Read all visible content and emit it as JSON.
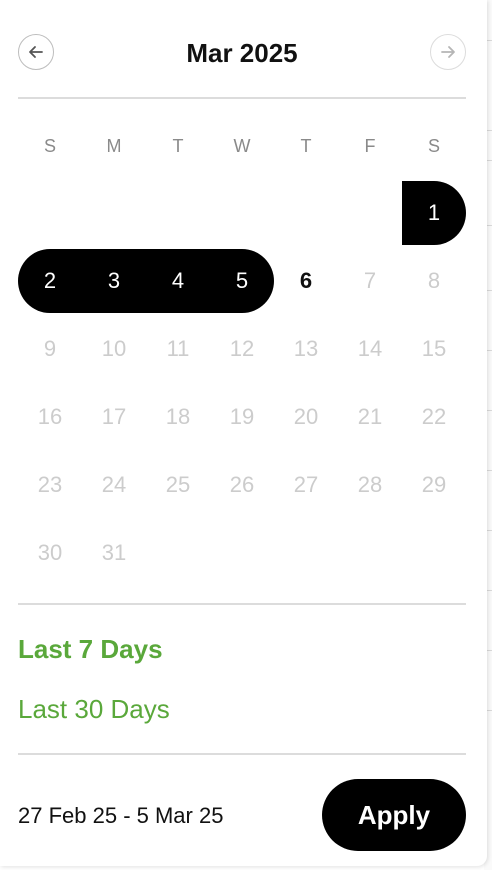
{
  "calendar": {
    "title": "Mar 2025",
    "weekdays": [
      "S",
      "M",
      "T",
      "W",
      "T",
      "F",
      "S"
    ],
    "weeks": [
      [
        null,
        null,
        null,
        null,
        null,
        null,
        {
          "day": "1",
          "state": "selected"
        }
      ],
      [
        {
          "day": "2",
          "state": "selected"
        },
        {
          "day": "3",
          "state": "selected"
        },
        {
          "day": "4",
          "state": "selected"
        },
        {
          "day": "5",
          "state": "selected"
        },
        {
          "day": "6",
          "state": "today"
        },
        {
          "day": "7",
          "state": "disabled"
        },
        {
          "day": "8",
          "state": "disabled"
        }
      ],
      [
        {
          "day": "9",
          "state": "disabled"
        },
        {
          "day": "10",
          "state": "disabled"
        },
        {
          "day": "11",
          "state": "disabled"
        },
        {
          "day": "12",
          "state": "disabled"
        },
        {
          "day": "13",
          "state": "disabled"
        },
        {
          "day": "14",
          "state": "disabled"
        },
        {
          "day": "15",
          "state": "disabled"
        }
      ],
      [
        {
          "day": "16",
          "state": "disabled"
        },
        {
          "day": "17",
          "state": "disabled"
        },
        {
          "day": "18",
          "state": "disabled"
        },
        {
          "day": "19",
          "state": "disabled"
        },
        {
          "day": "20",
          "state": "disabled"
        },
        {
          "day": "21",
          "state": "disabled"
        },
        {
          "day": "22",
          "state": "disabled"
        }
      ],
      [
        {
          "day": "23",
          "state": "disabled"
        },
        {
          "day": "24",
          "state": "disabled"
        },
        {
          "day": "25",
          "state": "disabled"
        },
        {
          "day": "26",
          "state": "disabled"
        },
        {
          "day": "27",
          "state": "disabled"
        },
        {
          "day": "28",
          "state": "disabled"
        },
        {
          "day": "29",
          "state": "disabled"
        }
      ],
      [
        {
          "day": "30",
          "state": "disabled"
        },
        {
          "day": "31",
          "state": "disabled"
        },
        null,
        null,
        null,
        null,
        null
      ]
    ]
  },
  "quick_ranges": [
    {
      "label": "Last 7 Days",
      "active": true
    },
    {
      "label": "Last 30 Days",
      "active": false
    }
  ],
  "footer": {
    "range_text": "27 Feb 25 - 5 Mar 25",
    "apply_label": "Apply"
  },
  "icons": {
    "prev": "arrow-left-icon",
    "next": "arrow-right-icon"
  },
  "colors": {
    "accent_green": "#5aa83b",
    "selection": "#000000",
    "disabled_text": "#cccccc"
  }
}
